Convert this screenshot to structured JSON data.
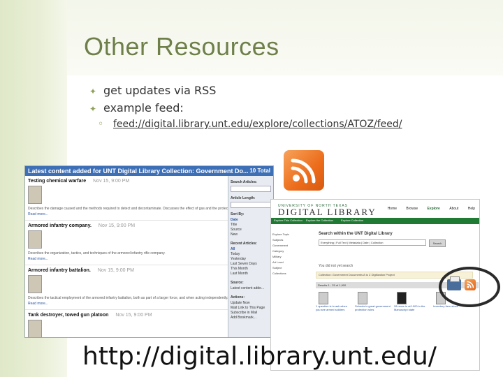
{
  "slide": {
    "title": "Other Resources",
    "bullets": [
      {
        "text": "get updates via RSS"
      },
      {
        "text": "example feed:"
      }
    ],
    "sub_bullet": {
      "marker": "◦",
      "text": "feed://digital.library.unt.edu/explore/collections/ATOZ/feed/"
    },
    "url_caption": "http://digital.library.unt.edu/"
  },
  "feed_reader": {
    "header": "Latest content added for UNT Digital Library Collection: Government Do...",
    "header_right": "10 Total",
    "entries": [
      {
        "title": "Testing chemical warfare",
        "date": "Nov 15, 9:00 PM",
        "desc": "Describes the damage caused and the methods required to detect and decontaminate. Discusses the effect of gas and the protective management",
        "more": "Read more..."
      },
      {
        "title": "Armored infantry company.",
        "date": "Nov 15, 9:00 PM",
        "desc": "Describes the organization, tactics, and techniques of the armored infantry rifle company.",
        "more": "Read more..."
      },
      {
        "title": "Armored infantry battalion.",
        "date": "Nov 15, 9:00 PM",
        "desc": "Describes the tactical employment of the armored infantry battalion, both as part of a larger force, and when acting independently.",
        "more": "Read more..."
      },
      {
        "title": "Tank destroyer, towed gun platoon",
        "date": "Nov 15, 9:00 PM",
        "desc": "",
        "more": ""
      }
    ],
    "side": {
      "search_label": "Search Articles:",
      "length_label": "Article Length:",
      "sort_label": "Sort By:",
      "sort_items": [
        "Date",
        "Title",
        "Source",
        "New"
      ],
      "recent_label": "Recent Articles:",
      "recent_items": [
        "All",
        "Today",
        "Yesterday",
        "Last Seven Days",
        "This Month",
        "Last Month"
      ],
      "source_label": "Source:",
      "source_value": "Latest content adde...",
      "actions_label": "Actions:",
      "actions_items": [
        "Update Now",
        "Mail Link to This Page",
        "Subscribe in Mail",
        "Add Bookmark..."
      ]
    }
  },
  "library_site": {
    "brand_top": "UNIVERSITY OF NORTH TEXAS",
    "brand": "DIGITAL LIBRARY",
    "nav": [
      "Home",
      "Browse",
      "Explore",
      "About",
      "Help"
    ],
    "tabs": [
      "Explore This Collection",
      "Explore the Collection",
      "Explore Collection"
    ],
    "left_items": [
      "Explore Topic",
      "Subjects",
      "Government",
      "Category",
      "Military",
      "Art Level",
      "Subject",
      "Collections"
    ],
    "search_title": "Search within the UNT Digital Library",
    "search_value": "Everything | Full Text | Metadata | Date | Collection",
    "search_button": "Search",
    "notice": "You did not yet search",
    "notice_bar": "Collection: Government Documents A to Z Digitization Project",
    "results_bar": "Results 1 - 25 of 1,900",
    "sort_value": "Sort by: Date Added",
    "items": [
      {
        "title": "1 question is to ask when you see armed soldiers"
      },
      {
        "title": "Schools is great government protection rules"
      },
      {
        "title": "28 news in at 1000 in the Manuscript state"
      },
      {
        "title": "Inventory item stock"
      }
    ]
  },
  "colors": {
    "title": "#6e7f4a",
    "accent": "#8ea15a",
    "rss_orange": "#ec6c1b",
    "unt_green": "#217a34",
    "reader_blue": "#3d6fb7"
  },
  "icons": [
    "rss-feed-icon",
    "print-icon",
    "rss-small-icon"
  ]
}
